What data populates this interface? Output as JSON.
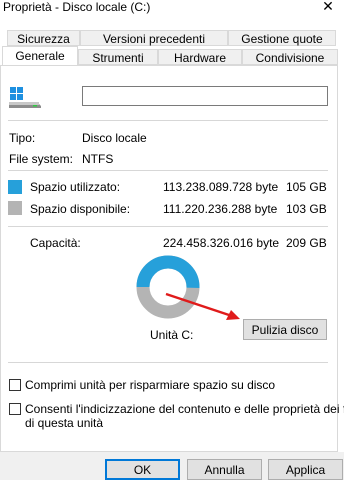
{
  "window": {
    "title": "Proprietà - Disco locale (C:)",
    "close_glyph": "✕"
  },
  "tabs_row1": [
    {
      "label": "Sicurezza"
    },
    {
      "label": "Versioni precedenti"
    },
    {
      "label": "Gestione quote"
    }
  ],
  "tabs_row2": [
    {
      "label": "Generale",
      "active": true
    },
    {
      "label": "Strumenti"
    },
    {
      "label": "Hardware"
    },
    {
      "label": "Condivisione"
    }
  ],
  "general": {
    "drive_icon": "drive-icon",
    "name_value": "",
    "type_label": "Tipo:",
    "type_value": "Disco locale",
    "fs_label": "File system:",
    "fs_value": "NTFS",
    "used_label": "Spazio utilizzato:",
    "used_bytes": "113.238.089.728 byte",
    "used_gb": "105 GB",
    "used_color": "#26a0da",
    "free_label": "Spazio disponibile:",
    "free_bytes": "111.220.236.288 byte",
    "free_gb": "103 GB",
    "free_color": "#b4b4b4",
    "capacity_label": "Capacità:",
    "capacity_bytes": "224.458.326.016 byte",
    "capacity_gb": "209 GB",
    "drive_label": "Unità C:",
    "cleanup_button": "Pulizia disco",
    "compress_label": "Comprimi unità per risparmiare spazio su disco",
    "index_label_line1": "Consenti l'indicizzazione del contenuto e delle proprietà dei file",
    "index_label_line2": "di questa unità"
  },
  "usage": {
    "used_fraction": 0.505
  },
  "footer": {
    "ok": "OK",
    "cancel": "Annulla",
    "apply": "Applica"
  }
}
